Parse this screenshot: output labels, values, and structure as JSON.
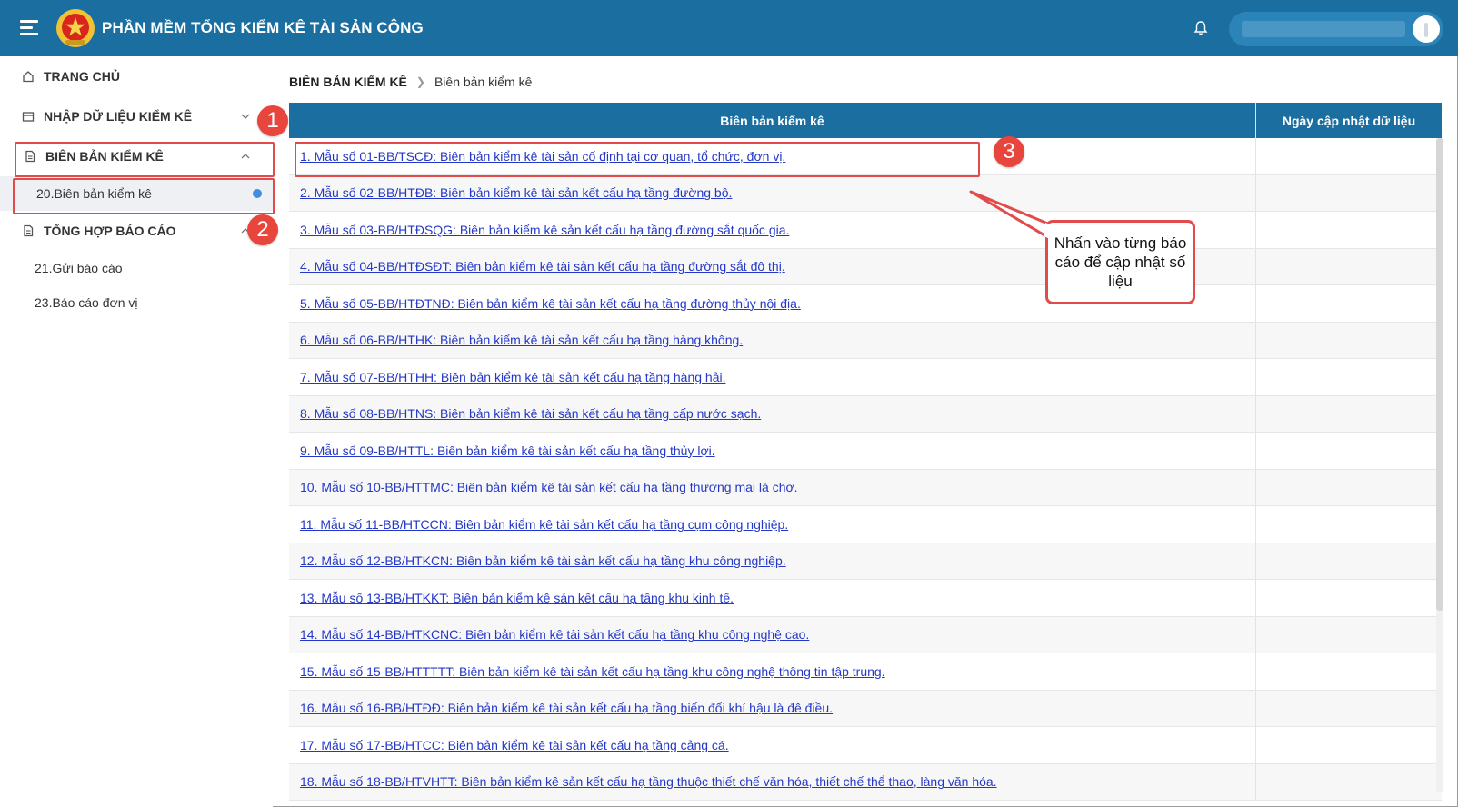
{
  "header": {
    "app_title": "PHẦN MỀM TỔNG KIỂM KÊ TÀI SẢN CÔNG",
    "bg_color": "#1b6fa0"
  },
  "sidebar": {
    "items": [
      {
        "label": "TRANG CHỦ",
        "icon": "home-icon"
      },
      {
        "label": "NHẬP DỮ LIỆU KIỂM KÊ",
        "icon": "inbox-icon"
      },
      {
        "label": "BIÊN BẢN KIỂM KÊ",
        "icon": "document-icon",
        "children": [
          {
            "label": "20.Biên bản kiểm kê",
            "active": true
          }
        ]
      },
      {
        "label": "TỔNG HỢP BÁO CÁO",
        "icon": "document-icon",
        "children": [
          {
            "label": "21.Gửi báo cáo"
          },
          {
            "label": "23.Báo cáo đơn vị"
          }
        ]
      }
    ]
  },
  "breadcrumb": {
    "root": "BIÊN BẢN KIỂM KÊ",
    "current": "Biên bản kiểm kê"
  },
  "table": {
    "headers": [
      "Biên bản kiểm kê",
      "Ngày cập nhật dữ liệu"
    ],
    "rows": [
      "1. Mẫu số 01-BB/TSCĐ: Biên bản kiểm kê tài sản cố định tại cơ quan, tổ chức, đơn vị.",
      "2. Mẫu số 02-BB/HTĐB: Biên bản kiểm kê tài sản kết cấu hạ tầng đường bộ.",
      "3. Mẫu số 03-BB/HTĐSQG: Biên bản kiểm kê sản kết cấu hạ tầng đường sắt quốc gia.",
      "4. Mẫu số 04-BB/HTĐSĐT: Biên bản kiểm kê tài sản kết cấu hạ tầng đường sắt đô thị.",
      "5. Mẫu số 05-BB/HTĐTNĐ: Biên bản kiểm kê tài sản kết cấu hạ tầng đường thủy nội địa.",
      "6. Mẫu số 06-BB/HTHK: Biên bản kiểm kê tài sản kết cấu hạ tầng hàng không.",
      "7. Mẫu số 07-BB/HTHH: Biên bản kiểm kê tài sản kết cấu hạ tầng hàng hải.",
      "8. Mẫu số 08-BB/HTNS: Biên bản kiểm kê tài sản kết cấu hạ tầng cấp nước sạch.",
      "9. Mẫu số 09-BB/HTTL: Biên bản kiểm kê tài sản kết cấu hạ tầng thủy lợi.",
      "10. Mẫu số 10-BB/HTTMC: Biên bản kiểm kê tài sản kết cấu hạ tầng thương mại là chợ.",
      "11. Mẫu số 11-BB/HTCCN: Biên bản kiểm kê tài sản kết cấu hạ tầng cụm công nghiệp.",
      "12. Mẫu số 12-BB/HTKCN: Biên bản kiểm kê tài sản kết cấu hạ tầng khu công nghiệp.",
      "13. Mẫu số 13-BB/HTKKT: Biên bản kiểm kê sản kết cấu hạ tầng khu kinh tế.",
      "14. Mẫu số 14-BB/HTKCNC: Biên bản kiểm kê tài sản kết cấu hạ tầng khu công nghệ cao.",
      "15. Mẫu số 15-BB/HTTTTT: Biên bản kiểm kê tài sản kết cấu hạ tầng khu công nghệ thông tin tập trung.",
      "16. Mẫu số 16-BB/HTĐĐ: Biên bản kiểm kê tài sản kết cấu hạ tầng biến đổi khí hậu là đê điều.",
      "17. Mẫu số 17-BB/HTCC: Biên bản kiểm kê tài sản kết cấu hạ tầng cảng cá.",
      "18. Mẫu số 18-BB/HTVHTT: Biên bản kiểm kê sản kết cấu hạ tầng thuộc thiết chế văn hóa, thiết chế thể thao, làng văn hóa."
    ]
  },
  "annotations": {
    "badges": [
      "1",
      "2",
      "3"
    ],
    "callout_text": "Nhấn vào từng báo cáo để cập nhật số liệu",
    "highlight_color": "#e24b4b"
  }
}
